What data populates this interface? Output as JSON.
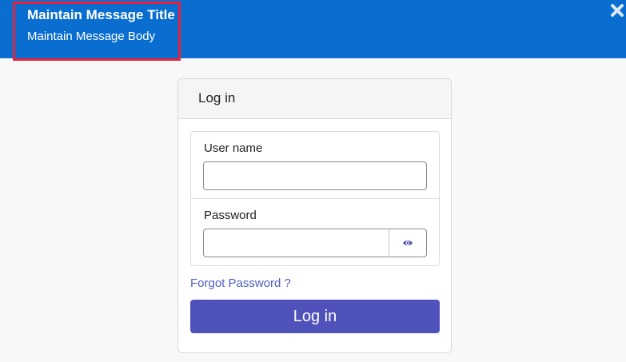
{
  "message": {
    "title": "Maintain Message Title",
    "body": "Maintain Message Body",
    "close_icon": "close-icon",
    "background_color": "#0a6ed1",
    "highlight_color": "#e8223a"
  },
  "login_card": {
    "header_title": "Log in",
    "username": {
      "label": "User name",
      "value": ""
    },
    "password": {
      "label": "Password",
      "value": "",
      "toggle_icon": "eye-icon"
    },
    "forgot_password_link": "Forgot Password ?",
    "submit_label": "Log in",
    "submit_color": "#5052bc",
    "link_color": "#4a5fc1"
  }
}
